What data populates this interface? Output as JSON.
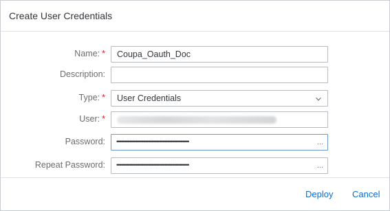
{
  "dialog": {
    "title": "Create User Credentials"
  },
  "form": {
    "name": {
      "label": "Name:",
      "required_mark": "*",
      "value": "Coupa_Oauth_Doc"
    },
    "description": {
      "label": "Description:",
      "value": ""
    },
    "type": {
      "label": "Type:",
      "required_mark": "*",
      "value": "User Credentials"
    },
    "user": {
      "label": "User:",
      "required_mark": "*"
    },
    "password": {
      "label": "Password:",
      "masked_value": "••••••••••••••••••••••••••••••••••••••••••••••••••••••••••••",
      "overflow": "..."
    },
    "repeat_password": {
      "label": "Repeat Password:",
      "masked_value": "••••••••••••••••••••••••••••••••••••••••••••••••••••••••••••",
      "overflow": "..."
    }
  },
  "footer": {
    "deploy_label": "Deploy",
    "cancel_label": "Cancel"
  },
  "colors": {
    "accent": "#0a6ed1",
    "required": "#e2171e",
    "label": "#6a6d70",
    "text": "#32363a",
    "focus_border": "#6a98c8"
  }
}
